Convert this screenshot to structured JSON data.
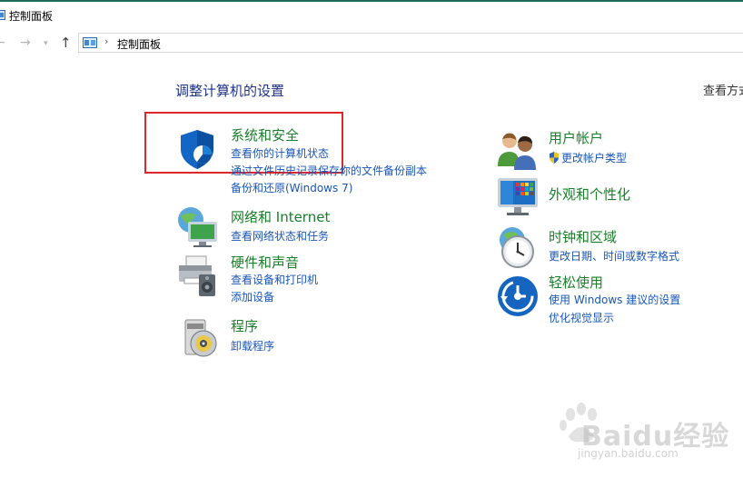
{
  "window": {
    "title": "控制面板"
  },
  "address_bar": {
    "path": "控制面板"
  },
  "main": {
    "heading": "调整计算机的设置",
    "view_by": "查看方式"
  },
  "categories_left": [
    {
      "title": "系统和安全",
      "links": [
        "查看你的计算机状态",
        "通过文件历史记录保存你的文件备份副本",
        "备份和还原(Windows 7)"
      ],
      "icon": "system-security-shield-icon"
    },
    {
      "title": "网络和 Internet",
      "links": [
        "查看网络状态和任务"
      ],
      "icon": "network-globe-icon"
    },
    {
      "title": "硬件和声音",
      "links": [
        "查看设备和打印机",
        "添加设备"
      ],
      "icon": "printer-speaker-icon"
    },
    {
      "title": "程序",
      "links": [
        "卸载程序"
      ],
      "icon": "programs-disc-icon"
    }
  ],
  "categories_right": [
    {
      "title": "用户帐户",
      "links": [
        "更改帐户类型"
      ],
      "icon": "users-icon"
    },
    {
      "title": "外观和个性化",
      "links": [],
      "icon": "monitor-palette-icon"
    },
    {
      "title": "时钟和区域",
      "links": [
        "更改日期、时间或数字格式"
      ],
      "icon": "clock-globe-icon"
    },
    {
      "title": "轻松使用",
      "links": [
        "使用 Windows 建议的设置",
        "优化视觉显示"
      ],
      "icon": "ease-of-access-icon"
    }
  ],
  "watermark": {
    "brand": "Baidu经验",
    "url": "jingyan.baidu.com"
  },
  "colors": {
    "title_green": "#1a7f2a",
    "link_blue": "#1a56b8",
    "heading_blue": "#1e3287",
    "highlight_red": "#e0262d"
  }
}
